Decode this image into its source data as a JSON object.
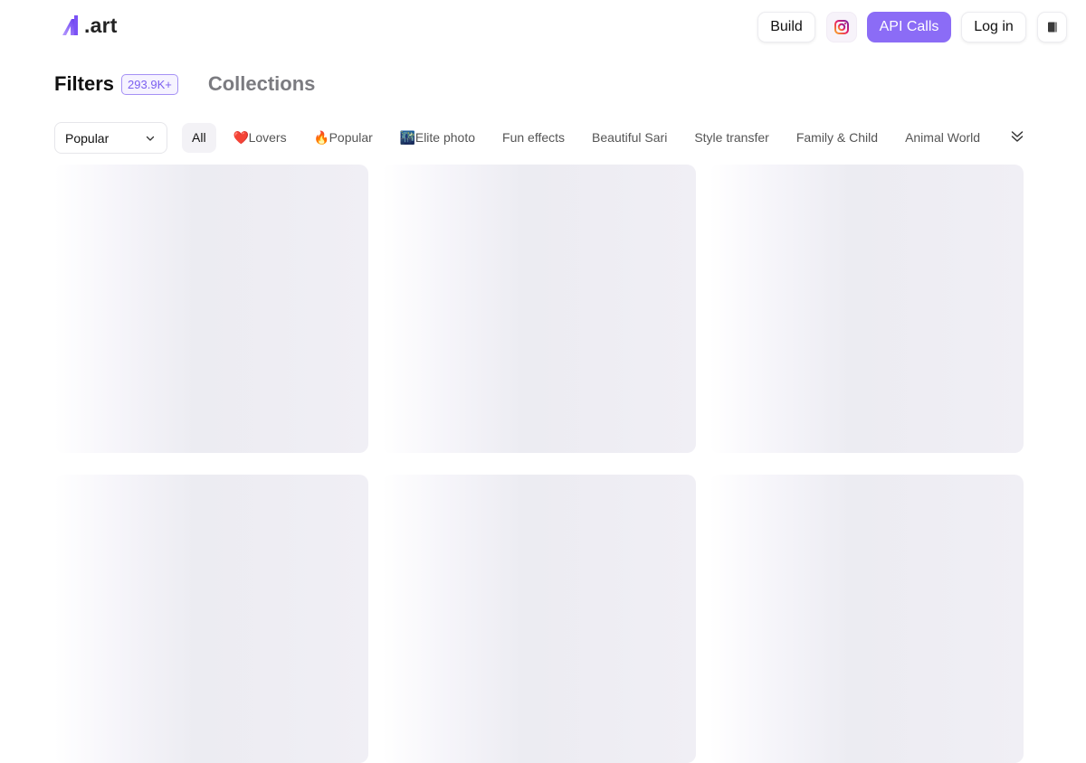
{
  "header": {
    "logo_text": ".art",
    "logo_icon": "a1-logo-icon",
    "buttons": {
      "build": "Build",
      "instagram_icon": "instagram-icon",
      "api_calls": "API Calls",
      "login": "Log in",
      "book_icon": "book-icon"
    },
    "colors": {
      "accent": "#8b6cf6",
      "badge": "#7c60f0"
    }
  },
  "tabs": {
    "filters_label": "Filters",
    "filters_count": "293.9K+",
    "collections_label": "Collections"
  },
  "filter_bar": {
    "sort_value": "Popular",
    "chips": [
      {
        "icon": "",
        "label": "All",
        "active": true
      },
      {
        "icon": "❤️",
        "label": "Lovers",
        "active": false
      },
      {
        "icon": "🔥",
        "label": "Popular",
        "active": false
      },
      {
        "icon": "🌃",
        "label": "Elite photo",
        "active": false
      },
      {
        "icon": "",
        "label": "Fun effects",
        "active": false
      },
      {
        "icon": "",
        "label": "Beautiful Sari",
        "active": false
      },
      {
        "icon": "",
        "label": "Style transfer",
        "active": false
      },
      {
        "icon": "",
        "label": "Family & Child",
        "active": false
      },
      {
        "icon": "",
        "label": "Animal World",
        "active": false
      }
    ],
    "expand_icon": "double-chevron-down-icon"
  },
  "grid": {
    "card_count": 6
  }
}
